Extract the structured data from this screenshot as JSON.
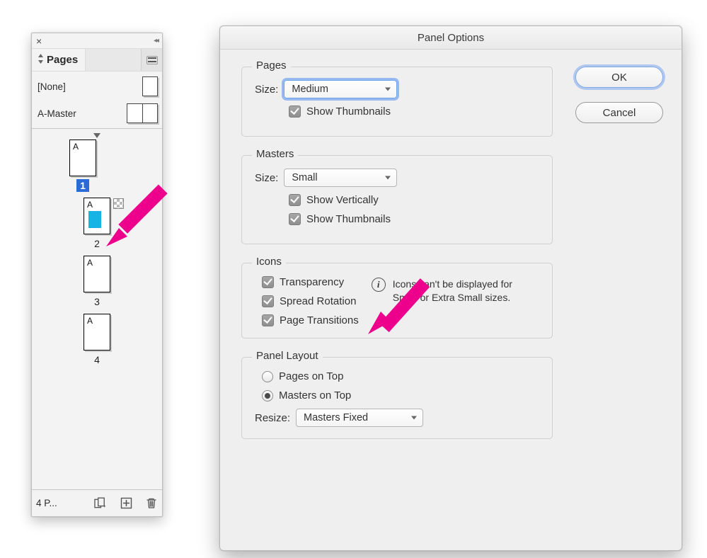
{
  "pages_panel": {
    "tab_label": "Pages",
    "masters": [
      {
        "name": "[None]"
      },
      {
        "name": "A-Master"
      }
    ],
    "pages": [
      {
        "master_letter": "A",
        "number": "1",
        "selected": true,
        "has_transparency": false,
        "has_cyan_block": false
      },
      {
        "master_letter": "A",
        "number": "2",
        "selected": false,
        "has_transparency": true,
        "has_cyan_block": true
      },
      {
        "master_letter": "A",
        "number": "3",
        "selected": false,
        "has_transparency": false,
        "has_cyan_block": false
      },
      {
        "master_letter": "A",
        "number": "4",
        "selected": false,
        "has_transparency": false,
        "has_cyan_block": false
      }
    ],
    "footer_text": "4 P..."
  },
  "dialog": {
    "title": "Panel Options",
    "sections": {
      "pages": {
        "title": "Pages",
        "size_label": "Size:",
        "size_value": "Medium",
        "show_thumbnails": "Show Thumbnails"
      },
      "masters": {
        "title": "Masters",
        "size_label": "Size:",
        "size_value": "Small",
        "show_vertically": "Show Vertically",
        "show_thumbnails": "Show Thumbnails"
      },
      "icons": {
        "title": "Icons",
        "transparency": "Transparency",
        "spread_rotation": "Spread Rotation",
        "page_transitions": "Page Transitions",
        "info": "Icons can't be displayed for Small or Extra Small sizes."
      },
      "panel_layout": {
        "title": "Panel Layout",
        "pages_on_top": "Pages on Top",
        "masters_on_top": "Masters on Top",
        "resize_label": "Resize:",
        "resize_value": "Masters Fixed"
      }
    },
    "buttons": {
      "ok": "OK",
      "cancel": "Cancel"
    }
  }
}
